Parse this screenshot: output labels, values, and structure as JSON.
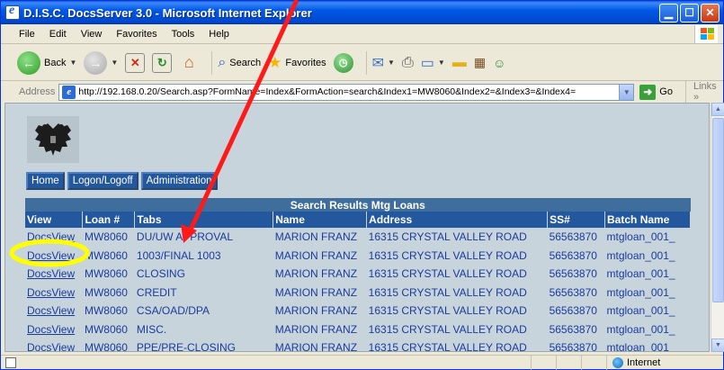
{
  "window": {
    "title": "D.I.S.C. DocsServer 3.0 - Microsoft Internet Explorer"
  },
  "menu": [
    "File",
    "Edit",
    "View",
    "Favorites",
    "Tools",
    "Help"
  ],
  "toolbar": {
    "back_label": "Back",
    "search_label": "Search",
    "favorites_label": "Favorites"
  },
  "address": {
    "label": "Address",
    "url": "http://192.168.0.20/Search.asp?FormName=Index&FormAction=search&Index1=MW8060&Index2=&Index3=&Index4=",
    "go_label": "Go",
    "links_label": "Links"
  },
  "nav": {
    "home": "Home",
    "logon": "Logon/Logoff",
    "admin": "Administration"
  },
  "results": {
    "caption": "Search Results Mtg Loans",
    "columns": [
      "View",
      "Loan #",
      "Tabs",
      "Name",
      "Address",
      "SS#",
      "Batch Name"
    ],
    "rows": [
      [
        "DocsView",
        "MW8060",
        "DU/UW APPROVAL",
        "MARION FRANZ",
        "16315 CRYSTAL VALLEY ROAD",
        "56563870",
        "mtgloan_001_"
      ],
      [
        "DocsView",
        "MW8060",
        "1003/FINAL 1003",
        "MARION FRANZ",
        "16315 CRYSTAL VALLEY ROAD",
        "56563870",
        "mtgloan_001_"
      ],
      [
        "DocsView",
        "MW8060",
        "CLOSING",
        "MARION FRANZ",
        "16315 CRYSTAL VALLEY ROAD",
        "56563870",
        "mtgloan_001_"
      ],
      [
        "DocsView",
        "MW8060",
        "CREDIT",
        "MARION FRANZ",
        "16315 CRYSTAL VALLEY ROAD",
        "56563870",
        "mtgloan_001_"
      ],
      [
        "DocsView",
        "MW8060",
        "CSA/OAD/DPA",
        "MARION FRANZ",
        "16315 CRYSTAL VALLEY ROAD",
        "56563870",
        "mtgloan_001_"
      ],
      [
        "DocsView",
        "MW8060",
        "MISC.",
        "MARION FRANZ",
        "16315 CRYSTAL VALLEY ROAD",
        "56563870",
        "mtgloan_001_"
      ],
      [
        "DocsView",
        "MW8060",
        "PPE/PRE-CLOSING",
        "MARION FRANZ",
        "16315 CRYSTAL VALLEY ROAD",
        "56563870",
        "mtgloan_001_"
      ]
    ]
  },
  "status": {
    "zone": "Internet"
  },
  "colors": {
    "annotation_arrow": "#ff1a1a",
    "annotation_circle": "#ffff00",
    "header_bg": "#23579e",
    "content_bg": "#c8d4dc"
  }
}
